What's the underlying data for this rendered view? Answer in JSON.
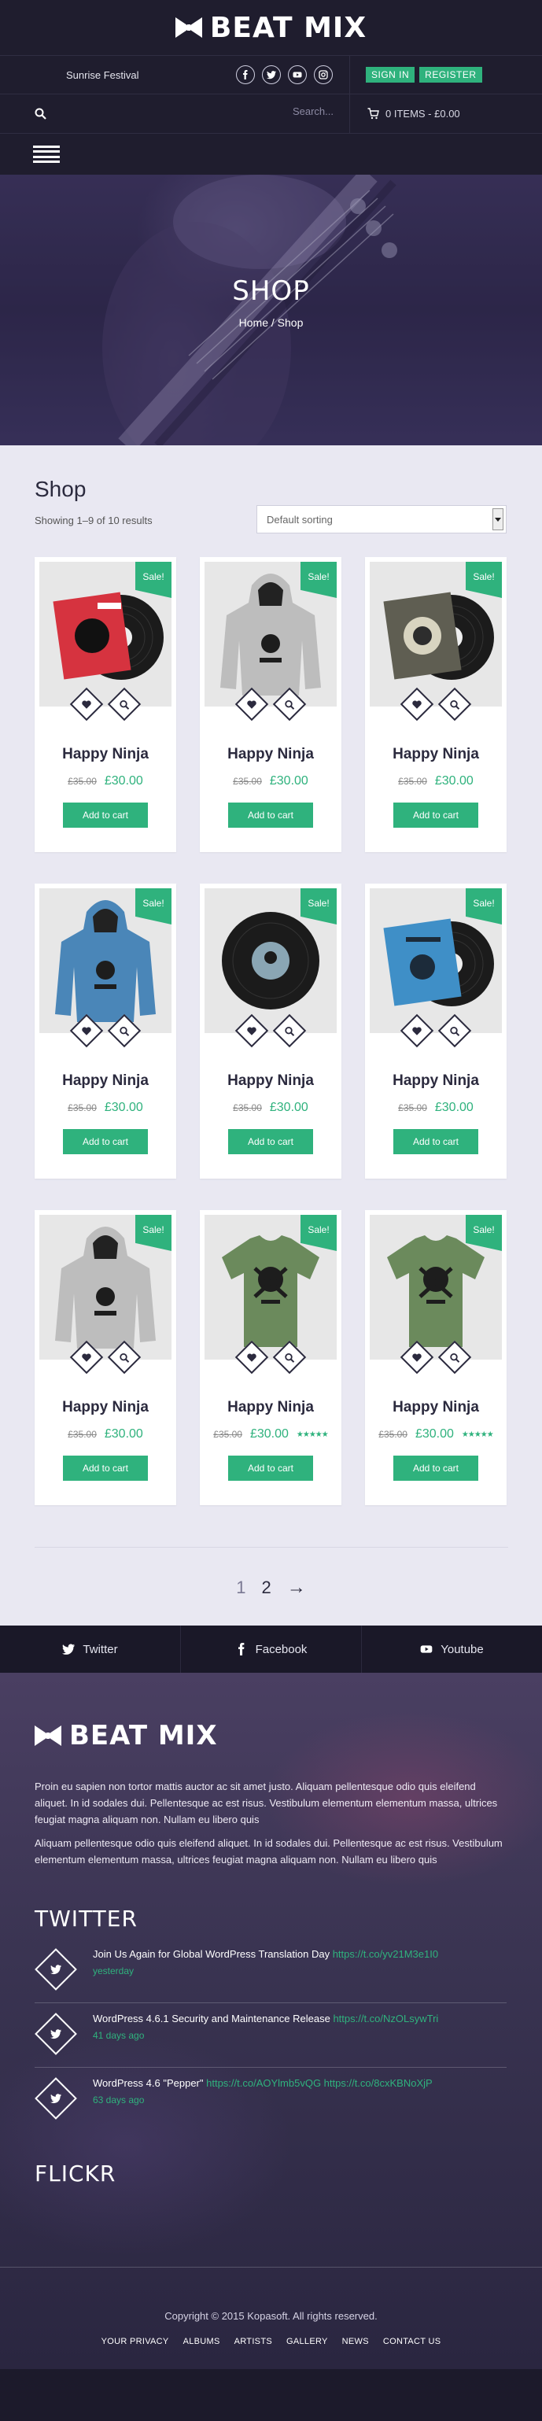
{
  "header": {
    "logo_text": "BEAT MIX",
    "tagline": "Sunrise Festival",
    "social": [
      "facebook-icon",
      "twitter-icon",
      "youtube-icon",
      "instagram-icon"
    ],
    "sign_in": "SIGN IN",
    "register": "REGISTER",
    "search_placeholder": "Search...",
    "cart_text": "0 ITEMS - £0.00"
  },
  "hero": {
    "title": "SHOP",
    "breadcrumb": "Home / Shop"
  },
  "shop": {
    "title": "Shop",
    "result_count": "Showing 1–9 of 10 results",
    "sort_selected": "Default sorting",
    "products": [
      {
        "sale": "Sale!",
        "name": "Happy Ninja",
        "old_price": "£35.00",
        "price": "£30.00",
        "button": "Add to cart",
        "image": "vinyl-red-sleeve",
        "rating": 0
      },
      {
        "sale": "Sale!",
        "name": "Happy Ninja",
        "old_price": "£35.00",
        "price": "£30.00",
        "button": "Add to cart",
        "image": "hoodie-grey",
        "rating": 0
      },
      {
        "sale": "Sale!",
        "name": "Happy Ninja",
        "old_price": "£35.00",
        "price": "£30.00",
        "button": "Add to cart",
        "image": "vinyl-dark-sleeve",
        "rating": 0
      },
      {
        "sale": "Sale!",
        "name": "Happy Ninja",
        "old_price": "£35.00",
        "price": "£30.00",
        "button": "Add to cart",
        "image": "hoodie-blue",
        "rating": 0
      },
      {
        "sale": "Sale!",
        "name": "Happy Ninja",
        "old_price": "£35.00",
        "price": "£30.00",
        "button": "Add to cart",
        "image": "vinyl-black",
        "rating": 0
      },
      {
        "sale": "Sale!",
        "name": "Happy Ninja",
        "old_price": "£35.00",
        "price": "£30.00",
        "button": "Add to cart",
        "image": "vinyl-blue-sleeve",
        "rating": 0
      },
      {
        "sale": "Sale!",
        "name": "Happy Ninja",
        "old_price": "£35.00",
        "price": "£30.00",
        "button": "Add to cart",
        "image": "hoodie-grey",
        "rating": 0
      },
      {
        "sale": "Sale!",
        "name": "Happy Ninja",
        "old_price": "£35.00",
        "price": "£30.00",
        "button": "Add to cart",
        "image": "tshirt-green",
        "rating": 5
      },
      {
        "sale": "Sale!",
        "name": "Happy Ninja",
        "old_price": "£35.00",
        "price": "£30.00",
        "button": "Add to cart",
        "image": "tshirt-green",
        "rating": 4.5
      }
    ],
    "pagination": {
      "page1": "1",
      "page2": "2",
      "next": "→"
    }
  },
  "social_strip": [
    {
      "icon": "twitter-icon",
      "label": "Twitter"
    },
    {
      "icon": "facebook-icon",
      "label": "Facebook"
    },
    {
      "icon": "youtube-icon",
      "label": "Youtube"
    }
  ],
  "footer": {
    "logo_text": "BEAT MIX",
    "para1": "Proin eu sapien non tortor mattis auctor ac sit amet justo. Aliquam pellentesque odio quis eleifend aliquet. In id sodales dui. Pellentesque ac est risus. Vestibulum elementum elementum massa, ultrices feugiat magna aliquam non. Nullam eu libero quis",
    "para2": "Aliquam pellentesque odio quis eleifend aliquet. In id sodales dui. Pellentesque ac est risus. Vestibulum elementum elementum massa, ultrices feugiat magna aliquam non. Nullam eu libero quis",
    "twitter_heading": "TWITTER",
    "tweets": [
      {
        "text": "Join Us Again for Global WordPress Translation Day ",
        "link": "https://t.co/yv21M3e1I0",
        "ago": "yesterday"
      },
      {
        "text": "WordPress 4.6.1 Security and Maintenance Release ",
        "link": "https://t.co/NzOLsywTri",
        "ago": "41 days ago"
      },
      {
        "text": "WordPress 4.6 \"Pepper\" ",
        "link": "https://t.co/AOYlmb5vQG https://t.co/8cxKBNoXjP",
        "ago": "63 days ago"
      }
    ],
    "flickr_heading": "FLICKR",
    "copyright": "Copyright © 2015 Kopasoft. All rights reserved.",
    "nav": [
      "YOUR PRIVACY",
      "ALBUMS",
      "ARTISTS",
      "GALLERY",
      "NEWS",
      "CONTACT US"
    ]
  },
  "colors": {
    "accent": "#2fb27d",
    "dark": "#1f1d2e",
    "shop_bg": "#e9e8f2"
  }
}
